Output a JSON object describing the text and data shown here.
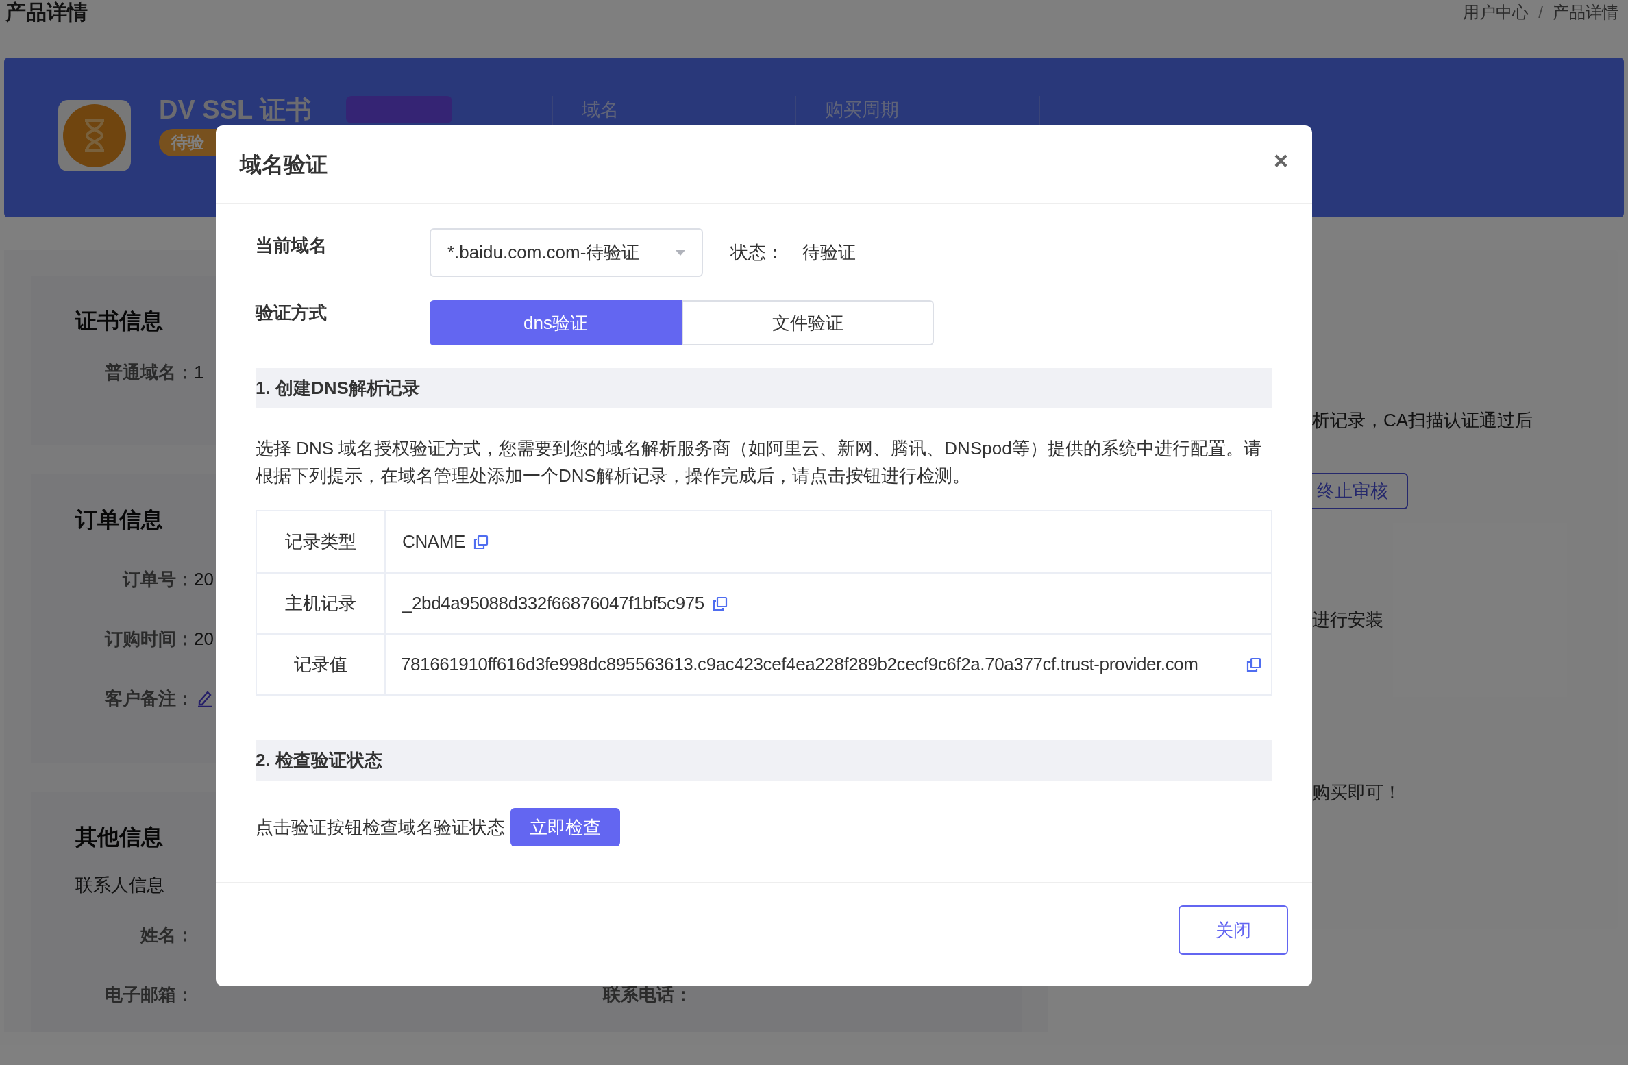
{
  "page": {
    "title": "产品详情",
    "breadcrumb": [
      {
        "label": "用户中心"
      },
      {
        "label": "产品详情"
      }
    ],
    "separator": "/"
  },
  "banner": {
    "product_name": "DV SSL 证书",
    "status_badge": "待验",
    "columns": [
      {
        "label": "域名"
      },
      {
        "label": "购买周期"
      }
    ]
  },
  "cards": [
    {
      "title": "证书信息",
      "fields": [
        {
          "kind": "text",
          "label": "普通域名：",
          "value": "1"
        }
      ]
    },
    {
      "title": "订单信息",
      "fields": [
        {
          "kind": "text",
          "label": "订单号：",
          "value": "20"
        },
        {
          "kind": "text",
          "label": "订购时间：",
          "value": "20"
        },
        {
          "kind": "edit",
          "label": "客户备注："
        }
      ]
    },
    {
      "title": "其他信息",
      "subtitle": "联系人信息",
      "fields": [
        {
          "kind": "text",
          "label": "姓名："
        },
        {
          "kind": "pair",
          "label": "电子邮箱：",
          "label_2": "联系电话："
        }
      ]
    }
  ],
  "right_panel": {
    "text": "析记录，CA扫描认证通过后",
    "button": "终止审核",
    "notes": [
      "进行安装",
      "购买即可！"
    ]
  },
  "modal": {
    "title": "域名验证",
    "close": "×",
    "domain_label": "当前域名",
    "domain_value": "*.baidu.com.com-待验证",
    "status_label": "状态：",
    "status_value": "待验证",
    "method_label": "验证方式",
    "methods": [
      {
        "label": "dns验证",
        "selected": true
      },
      {
        "label": "文件验证",
        "selected": false
      }
    ],
    "section_1": "1. 创建DNS解析记录",
    "description": "选择 DNS 域名授权验证方式，您需要到您的域名解析服务商（如阿里云、新网、腾讯、DNSpod等）提供的系统中进行配置。请根据下列提示，在域名管理处添加一个DNS解析记录，操作完成后，请点击按钮进行检测。",
    "records": [
      {
        "label": "记录类型",
        "value": "CNAME"
      },
      {
        "label": "主机记录",
        "value": "_2bd4a95088d332f66876047f1bf5c975"
      },
      {
        "label": "记录值",
        "value": "781661910ff616d3fe998dc895563613.c9ac423cef4ea228f289b2cecf9c6f2a.70a377cf.trust-provider.com"
      }
    ],
    "section_2": "2. 检查验证状态",
    "check_text": "点击验证按钮检查域名验证状态",
    "check_button": "立即检查",
    "footer_button": "关闭"
  }
}
